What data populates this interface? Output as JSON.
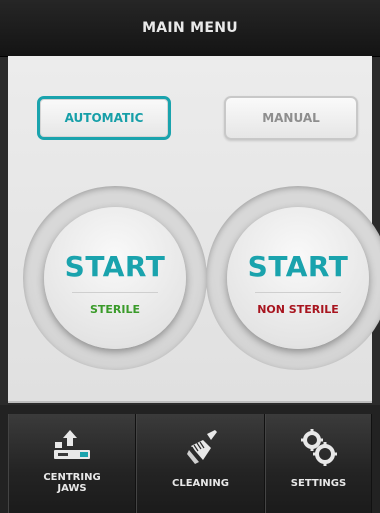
{
  "header": {
    "title": "MAIN MENU"
  },
  "mode": {
    "automatic_label": "AUTOMATIC",
    "manual_label": "MANUAL",
    "selected": "AUTOMATIC"
  },
  "start_buttons": [
    {
      "label": "START",
      "sub_label": "STERILE"
    },
    {
      "label": "START",
      "sub_label": "NON STERILE"
    }
  ],
  "tabs": [
    {
      "label_line1": "CENTRING",
      "label_line2": "JAWS",
      "icon": "centring-jaws-icon"
    },
    {
      "label": "CLEANING",
      "icon": "brush-icon"
    },
    {
      "label": "SETTINGS",
      "icon": "gears-icon"
    }
  ],
  "colors": {
    "accent": "#1aa3ad",
    "sterile": "#3a9b2a",
    "non_sterile": "#a8151f"
  }
}
